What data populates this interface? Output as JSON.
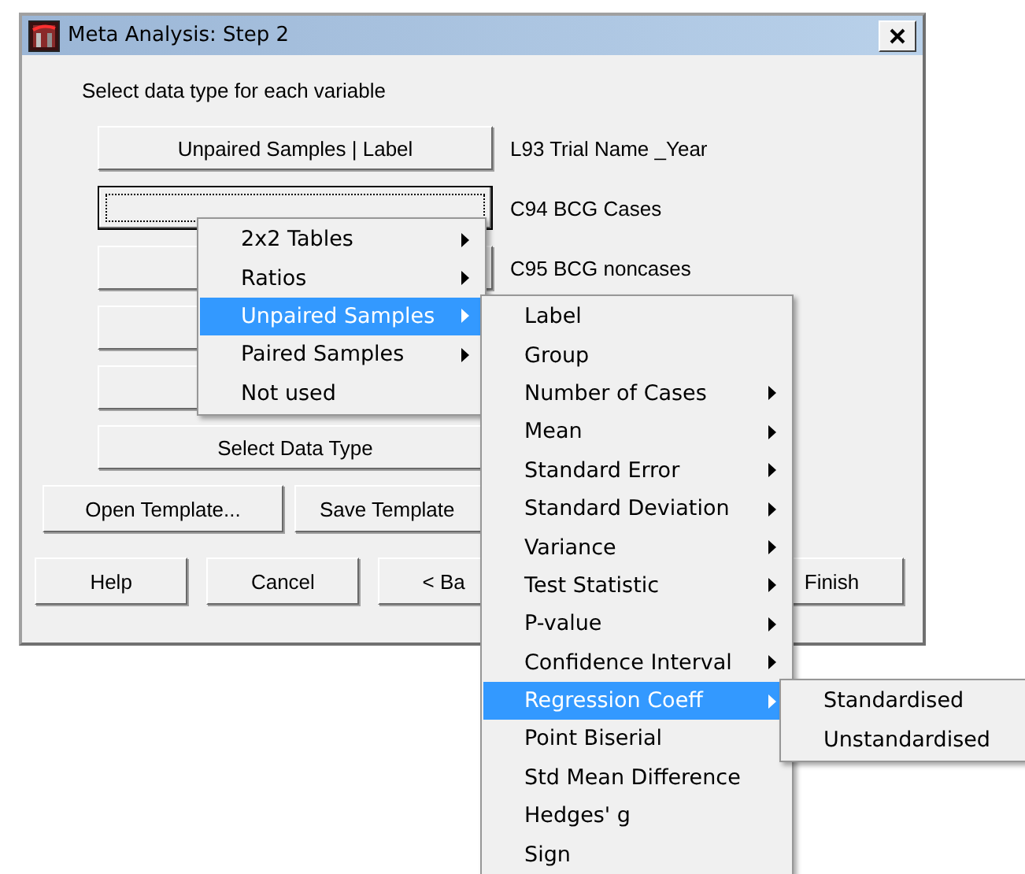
{
  "window": {
    "title": "Meta Analysis: Step 2"
  },
  "instruction": "Select data type for each variable",
  "variables": [
    {
      "button": "Unpaired Samples | Label",
      "name": "L93 Trial Name _Year",
      "focused": false
    },
    {
      "name": "C94 BCG Cases",
      "focused": true
    },
    {
      "name": "C95 BCG noncases",
      "focused": false
    },
    {
      "focused": false
    },
    {
      "focused": false
    },
    {
      "button": "Select Data Type",
      "focused": false
    }
  ],
  "template_buttons": [
    "Open Template...",
    "Save Template"
  ],
  "footer_buttons": [
    "Help",
    "Cancel",
    "< Ba",
    "Finish"
  ],
  "menus": [
    {
      "items": [
        {
          "label": "2x2 Tables",
          "submenu": true,
          "selected": false
        },
        {
          "label": "Ratios",
          "submenu": true,
          "selected": false
        },
        {
          "label": "Unpaired Samples",
          "submenu": true,
          "selected": true
        },
        {
          "label": "Paired Samples",
          "submenu": true,
          "selected": false
        },
        {
          "label": "Not used",
          "submenu": false,
          "selected": false
        }
      ]
    },
    {
      "items": [
        {
          "label": "Label",
          "submenu": false,
          "selected": false
        },
        {
          "label": "Group",
          "submenu": false,
          "selected": false
        },
        {
          "label": "Number of Cases",
          "submenu": true,
          "selected": false
        },
        {
          "label": "Mean",
          "submenu": true,
          "selected": false
        },
        {
          "label": "Standard Error",
          "submenu": true,
          "selected": false
        },
        {
          "label": "Standard Deviation",
          "submenu": true,
          "selected": false
        },
        {
          "label": "Variance",
          "submenu": true,
          "selected": false
        },
        {
          "label": "Test Statistic",
          "submenu": true,
          "selected": false
        },
        {
          "label": "P-value",
          "submenu": true,
          "selected": false
        },
        {
          "label": "Confidence Interval",
          "submenu": true,
          "selected": false
        },
        {
          "label": "Regression Coeff",
          "submenu": true,
          "selected": true
        },
        {
          "label": "Point Biserial",
          "submenu": false,
          "selected": false
        },
        {
          "label": "Std Mean Difference",
          "submenu": false,
          "selected": false
        },
        {
          "label": "Hedges' g",
          "submenu": false,
          "selected": false
        },
        {
          "label": "Sign",
          "submenu": false,
          "selected": false
        }
      ]
    },
    {
      "items": [
        {
          "label": "Standardised",
          "submenu": false,
          "selected": false
        },
        {
          "label": "Unstandardised",
          "submenu": false,
          "selected": false
        }
      ]
    }
  ]
}
